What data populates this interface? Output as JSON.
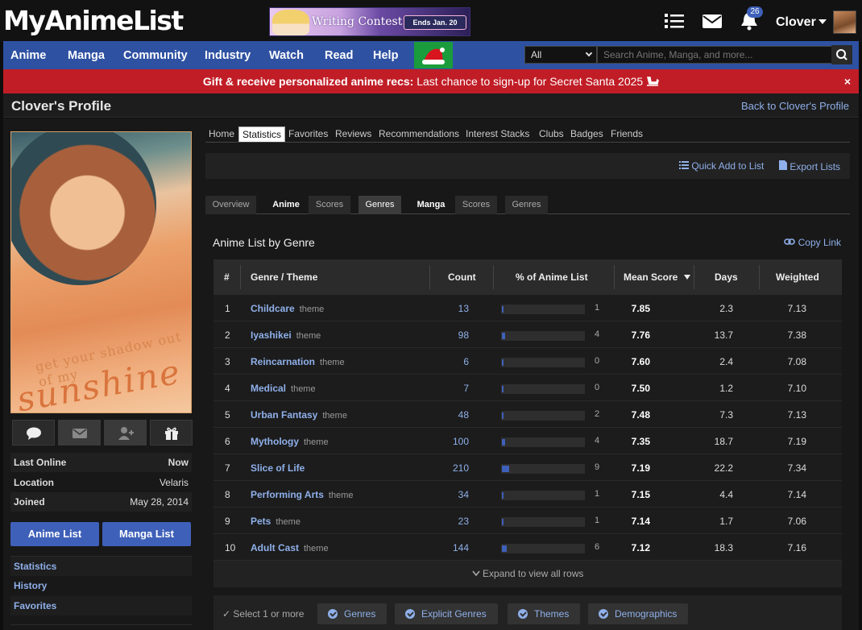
{
  "site": {
    "logo": "MyAnimeList"
  },
  "banner": {
    "title": "Writing Contest",
    "ends": "Ends Jan. 20"
  },
  "user": {
    "name": "Clover",
    "notifications": "26"
  },
  "nav": [
    "Anime",
    "Manga",
    "Community",
    "Industry",
    "Watch",
    "Read",
    "Help"
  ],
  "search": {
    "category": "All",
    "placeholder": "Search Anime, Manga, and more..."
  },
  "announcement": {
    "bold": "Gift & receive personalized anime recs:",
    "text": "Last chance to sign-up for Secret Santa 2025",
    "close": "×"
  },
  "header": {
    "title": "Clover's Profile",
    "back": "Back to Clover's Profile"
  },
  "sidebar": {
    "image_text_1": "get your shadow out of my",
    "image_text_2": "sunshine",
    "stats": [
      {
        "label": "Last Online",
        "value": "Now"
      },
      {
        "label": "Location",
        "value": "Velaris"
      },
      {
        "label": "Joined",
        "value": "May 28, 2014"
      }
    ],
    "anime_list": "Anime List",
    "manga_list": "Manga List",
    "links": [
      "Statistics",
      "History",
      "Favorites"
    ]
  },
  "profile_tabs": [
    "Home",
    "Statistics",
    "Favorites",
    "Reviews",
    "Recommendations",
    "Interest Stacks",
    "Clubs",
    "Badges",
    "Friends"
  ],
  "actions": {
    "quick_add": "Quick Add to List",
    "export": "Export Lists"
  },
  "sub_tabs": [
    "Overview",
    "Anime",
    "Scores",
    "Genres",
    "Manga",
    "Scores",
    "Genres"
  ],
  "section": {
    "title": "Anime List by Genre",
    "copy_link": "Copy Link"
  },
  "table": {
    "headers": [
      "#",
      "Genre / Theme",
      "Count",
      "% of Anime List",
      "Mean Score",
      "Days",
      "Weighted"
    ],
    "rows": [
      {
        "rank": "1",
        "genre": "Childcare",
        "tag": "theme",
        "count": "13",
        "pct": "1",
        "pct_fill": 1,
        "mean": "7.85",
        "days": "2.3",
        "weighted": "7.13"
      },
      {
        "rank": "2",
        "genre": "Iyashikei",
        "tag": "theme",
        "count": "98",
        "pct": "4",
        "pct_fill": 4,
        "mean": "7.76",
        "days": "13.7",
        "weighted": "7.38"
      },
      {
        "rank": "3",
        "genre": "Reincarnation",
        "tag": "theme",
        "count": "6",
        "pct": "0",
        "pct_fill": 0,
        "mean": "7.60",
        "days": "2.4",
        "weighted": "7.08"
      },
      {
        "rank": "4",
        "genre": "Medical",
        "tag": "theme",
        "count": "7",
        "pct": "0",
        "pct_fill": 0,
        "mean": "7.50",
        "days": "1.2",
        "weighted": "7.10"
      },
      {
        "rank": "5",
        "genre": "Urban Fantasy",
        "tag": "theme",
        "count": "48",
        "pct": "2",
        "pct_fill": 2,
        "mean": "7.48",
        "days": "7.3",
        "weighted": "7.13"
      },
      {
        "rank": "6",
        "genre": "Mythology",
        "tag": "theme",
        "count": "100",
        "pct": "4",
        "pct_fill": 4,
        "mean": "7.35",
        "days": "18.7",
        "weighted": "7.19"
      },
      {
        "rank": "7",
        "genre": "Slice of Life",
        "tag": "",
        "count": "210",
        "pct": "9",
        "pct_fill": 9,
        "mean": "7.19",
        "days": "22.2",
        "weighted": "7.34"
      },
      {
        "rank": "8",
        "genre": "Performing Arts",
        "tag": "theme",
        "count": "34",
        "pct": "1",
        "pct_fill": 1,
        "mean": "7.15",
        "days": "4.4",
        "weighted": "7.14"
      },
      {
        "rank": "9",
        "genre": "Pets",
        "tag": "theme",
        "count": "23",
        "pct": "1",
        "pct_fill": 1,
        "mean": "7.14",
        "days": "1.7",
        "weighted": "7.06"
      },
      {
        "rank": "10",
        "genre": "Adult Cast",
        "tag": "theme",
        "count": "144",
        "pct": "6",
        "pct_fill": 6,
        "mean": "7.12",
        "days": "18.3",
        "weighted": "7.16"
      }
    ],
    "expand": "Expand to view all rows"
  },
  "filters": {
    "label": "Select 1 or more",
    "buttons": [
      "Genres",
      "Explicit Genres",
      "Themes",
      "Demographics"
    ]
  },
  "colors": {
    "accent": "#3e60b9",
    "link": "#8fb0ea",
    "alert": "#c11d26",
    "nav": "#2e51a2"
  }
}
